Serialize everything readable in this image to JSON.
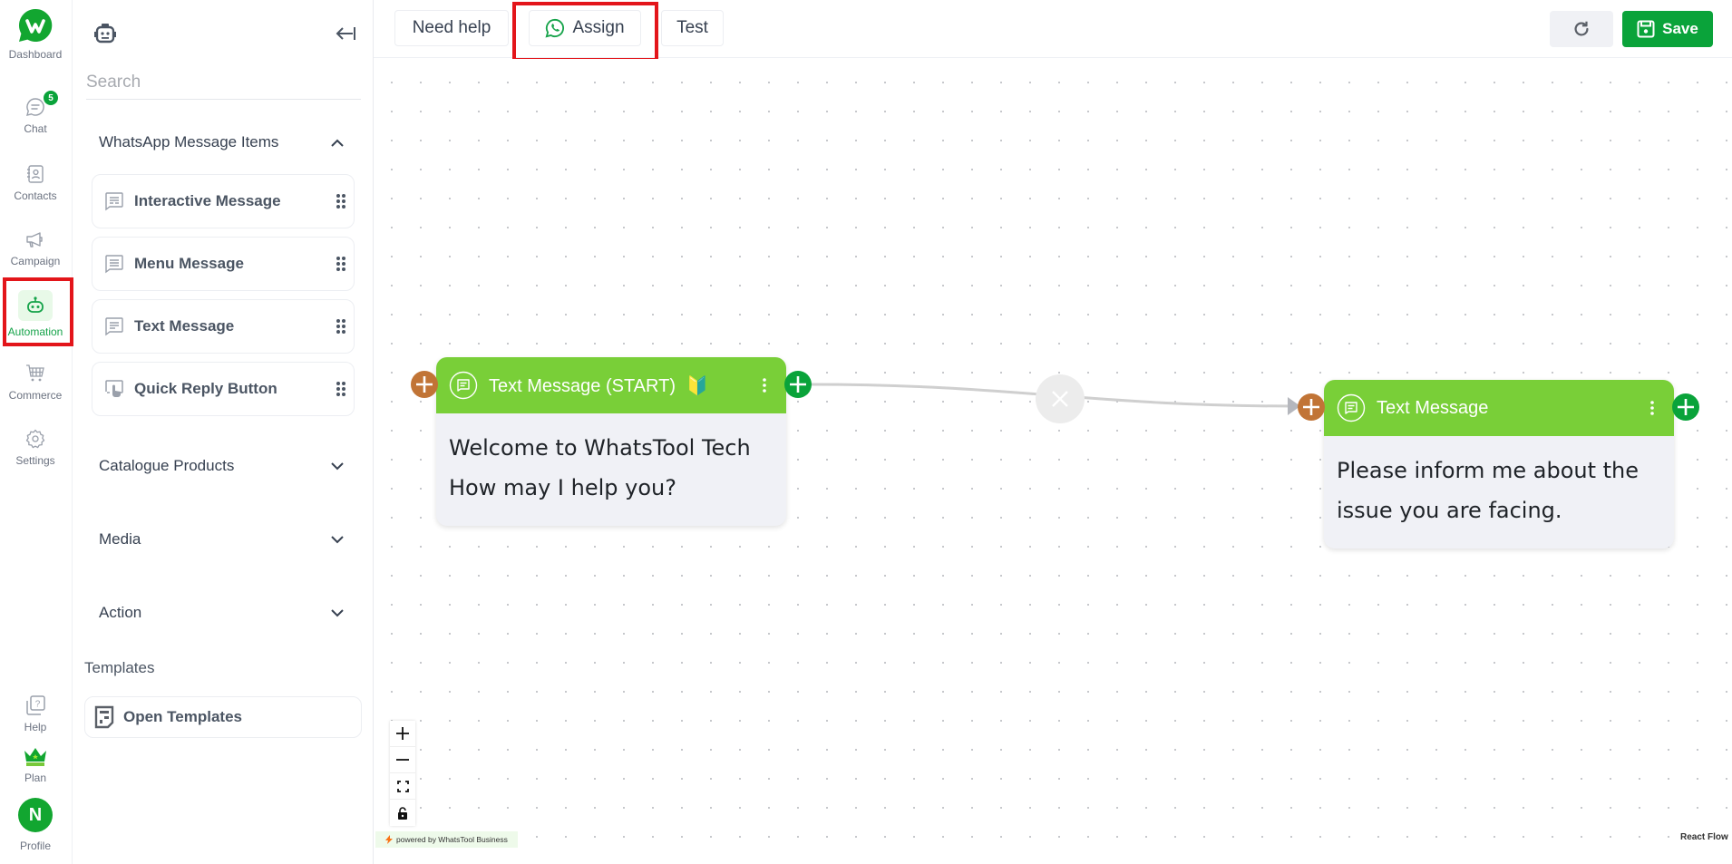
{
  "nav": {
    "items": [
      {
        "label": "Dashboard",
        "icon": "whatstool-logo-icon"
      },
      {
        "label": "Chat",
        "icon": "chat-icon",
        "badge": "5"
      },
      {
        "label": "Contacts",
        "icon": "contacts-icon"
      },
      {
        "label": "Campaign",
        "icon": "megaphone-icon"
      },
      {
        "label": "Automation",
        "icon": "robot-icon",
        "active": true
      },
      {
        "label": "Commerce",
        "icon": "cart-icon"
      },
      {
        "label": "Settings",
        "icon": "gear-icon"
      }
    ],
    "bottom": [
      {
        "label": "Help",
        "icon": "help-icon"
      },
      {
        "label": "Plan",
        "icon": "crown-icon"
      },
      {
        "label": "Profile",
        "avatar_letter": "N"
      }
    ]
  },
  "panel": {
    "search_placeholder": "Search",
    "sections": [
      {
        "title": "WhatsApp Message Items",
        "expanded": true,
        "items": [
          "Interactive Message",
          "Menu Message",
          "Text Message",
          "Quick Reply Button"
        ]
      },
      {
        "title": "Catalogue Products",
        "expanded": false
      },
      {
        "title": "Media",
        "expanded": false
      },
      {
        "title": "Action",
        "expanded": false
      }
    ],
    "templates_title": "Templates",
    "open_templates": "Open Templates"
  },
  "toolbar": {
    "need_help": "Need help",
    "assign": "Assign",
    "test": "Test",
    "save": "Save"
  },
  "flow": {
    "nodes": [
      {
        "title": "Text Message (START)",
        "start_badge": "🔰",
        "body": [
          "Welcome to WhatsTool Tech",
          "How may I help you?"
        ]
      },
      {
        "title": "Text Message",
        "body": [
          "Please inform me about the",
          "issue you are facing."
        ]
      }
    ],
    "edges": [
      {
        "from": 0,
        "to": 1
      }
    ]
  },
  "canvas": {
    "powered_by": "powered by WhatsTool Business",
    "attribution": "React Flow"
  },
  "colors": {
    "brand_green": "#0aa33a",
    "node_header": "#79cf38",
    "input_handle": "#c17436",
    "highlight_red": "#e3151a"
  }
}
